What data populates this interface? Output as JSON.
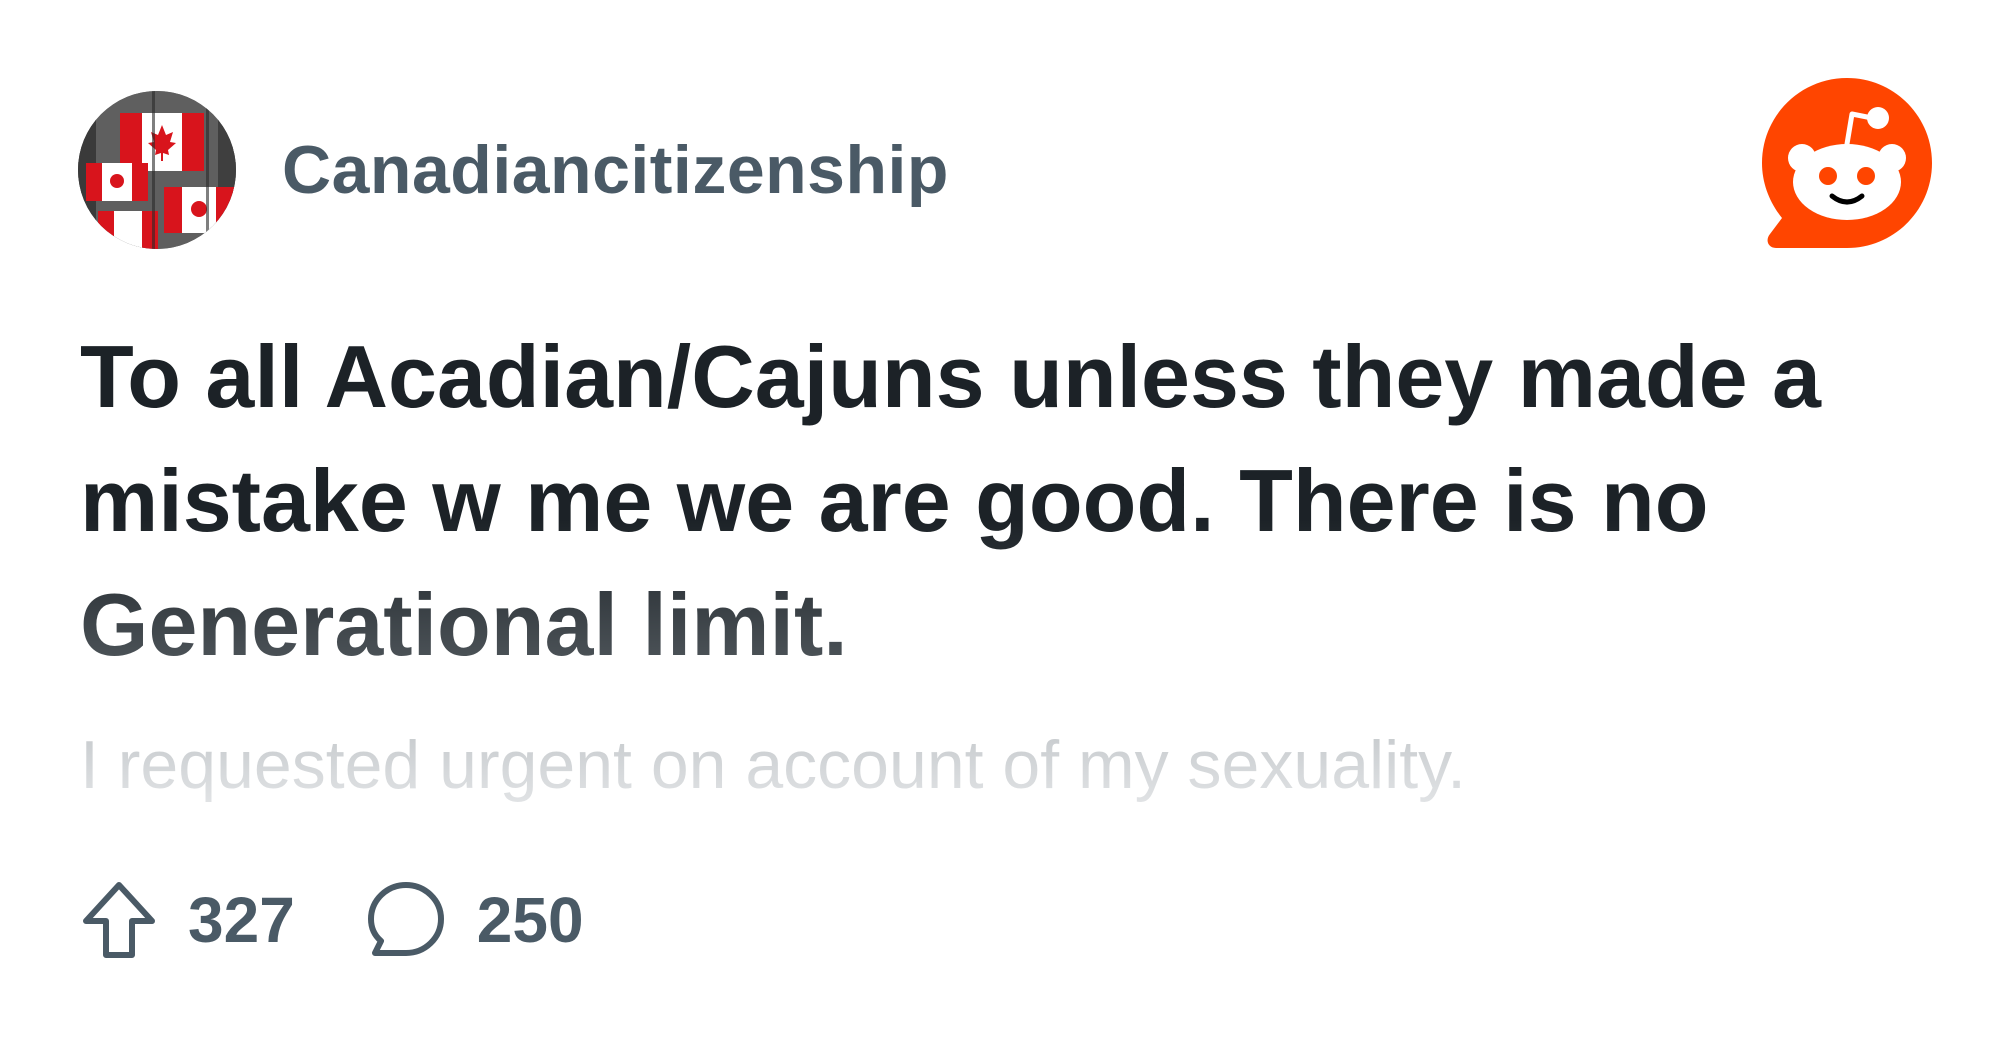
{
  "post": {
    "community_name": "Canadiancitizenship",
    "title": "To all Acadian/Cajuns unless they made a mistake w me we are good. There is no Generational limit.",
    "body_preview": "I requested urgent on account of my sexuality.",
    "upvotes": "327",
    "comments": "250"
  },
  "icons": {
    "avatar": "canada-flag-avatar",
    "brand": "reddit-snoo-logo",
    "upvote": "upvote-arrow-icon",
    "comment": "speech-bubble-icon"
  },
  "colors": {
    "brand_orange": "#ff4500",
    "text_dark": "#1c2227",
    "text_meta": "#4a5a66",
    "text_faded": "#c3c7ca"
  }
}
